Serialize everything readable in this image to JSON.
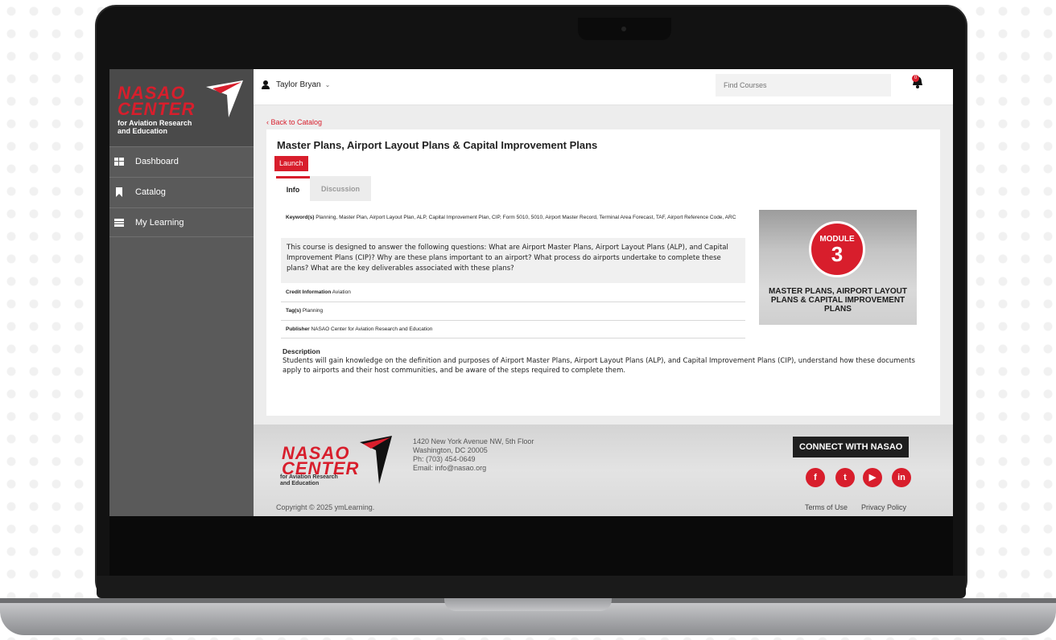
{
  "sidebar": {
    "logo_line1": "NASAO",
    "logo_line2": "CENTER",
    "logo_sub1": "for Aviation Research",
    "logo_sub2": "and Education",
    "items": [
      {
        "label": "Dashboard",
        "icon": "dashboard-grid-icon"
      },
      {
        "label": "Catalog",
        "icon": "bookmark-icon"
      },
      {
        "label": "My Learning",
        "icon": "list-icon"
      }
    ]
  },
  "topbar": {
    "user_name": "Taylor Bryan",
    "search_placeholder": "Find Courses",
    "notification_count": "0"
  },
  "main": {
    "back_link": "‹ Back to Catalog",
    "title": "Master Plans, Airport Layout Plans & Capital Improvement Plans",
    "launch_label": "Launch",
    "tabs": [
      {
        "label": "Info",
        "active": true
      },
      {
        "label": "Discussion",
        "active": false
      }
    ],
    "keywords_label": "Keyword(s)",
    "keywords_value": "Planning, Master Plan, Airport Layout Plan, ALP, Capital Improvement Plan, CIP, Form 5010, 5010, Airport Master Record, Terminal Area Forecast, TAF, Airport Reference Code, ARC",
    "summary": "This course is designed to answer the following questions: What are Airport Master Plans, Airport Layout Plans (ALP), and Capital Improvement Plans (CIP)? Why are these plans important to an airport? What process do airports undertake to complete these plans? What are the key deliverables associated with these plans?",
    "credit_label": "Credit Information",
    "credit_value": "Aviation",
    "tags_label": "Tag(s)",
    "tags_value": "Planning",
    "publisher_label": "Publisher",
    "publisher_value": "NASAO Center for Aviation Research and Education",
    "description_label": "Description",
    "description_text": "Students will gain knowledge on the definition and purposes of Airport Master Plans, Airport Layout Plans (ALP), and Capital Improvement Plans (CIP), understand how these documents apply to airports and their host communities, and be aware of the steps required to complete them.",
    "module_word": "MODULE",
    "module_number": "3",
    "module_caption": "MASTER PLANS, AIRPORT LAYOUT PLANS & CAPITAL IMPROVEMENT PLANS"
  },
  "footer": {
    "logo_line1": "NASAO",
    "logo_line2": "CENTER",
    "logo_sub1": "for Aviation Research",
    "logo_sub2": "and Education",
    "address_line1": "1420 New York Avenue NW, 5th Floor",
    "address_line2": "Washington, DC 20005",
    "phone": "Ph: (703) 454-0649",
    "email": "Email: info@nasao.org",
    "connect_label": "CONNECT WITH NASAO",
    "social": [
      {
        "name": "facebook-icon",
        "glyph": "f"
      },
      {
        "name": "twitter-icon",
        "glyph": "t"
      },
      {
        "name": "youtube-icon",
        "glyph": "▶"
      },
      {
        "name": "linkedin-icon",
        "glyph": "in"
      }
    ],
    "copyright": "Copyright © 2025 ymLearning.",
    "terms": "Terms of Use",
    "privacy": "Privacy Policy"
  },
  "colors": {
    "brand_red": "#d81e2c",
    "sidebar_bg": "#5a5a5a"
  }
}
